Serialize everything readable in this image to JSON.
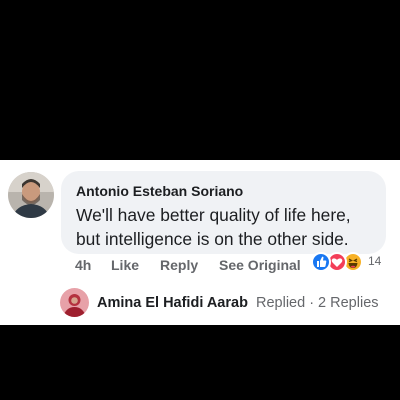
{
  "comment": {
    "author": "Antonio Esteban Soriano",
    "line1": "We'll have better quality of life here,",
    "line2": "but intelligence is on the other side.",
    "time": "4h",
    "like_label": "Like",
    "reply_label": "Reply",
    "see_original_label": "See Original",
    "reactions": {
      "icons": [
        "like-icon",
        "love-icon",
        "haha-icon"
      ],
      "colors": {
        "like": "#1877f2",
        "love": "#f33e58",
        "haha": "#f7b125"
      },
      "count": "14"
    }
  },
  "reply": {
    "author": "Amina El Hafidi Aarab",
    "status": "Replied · 2 Replies"
  }
}
